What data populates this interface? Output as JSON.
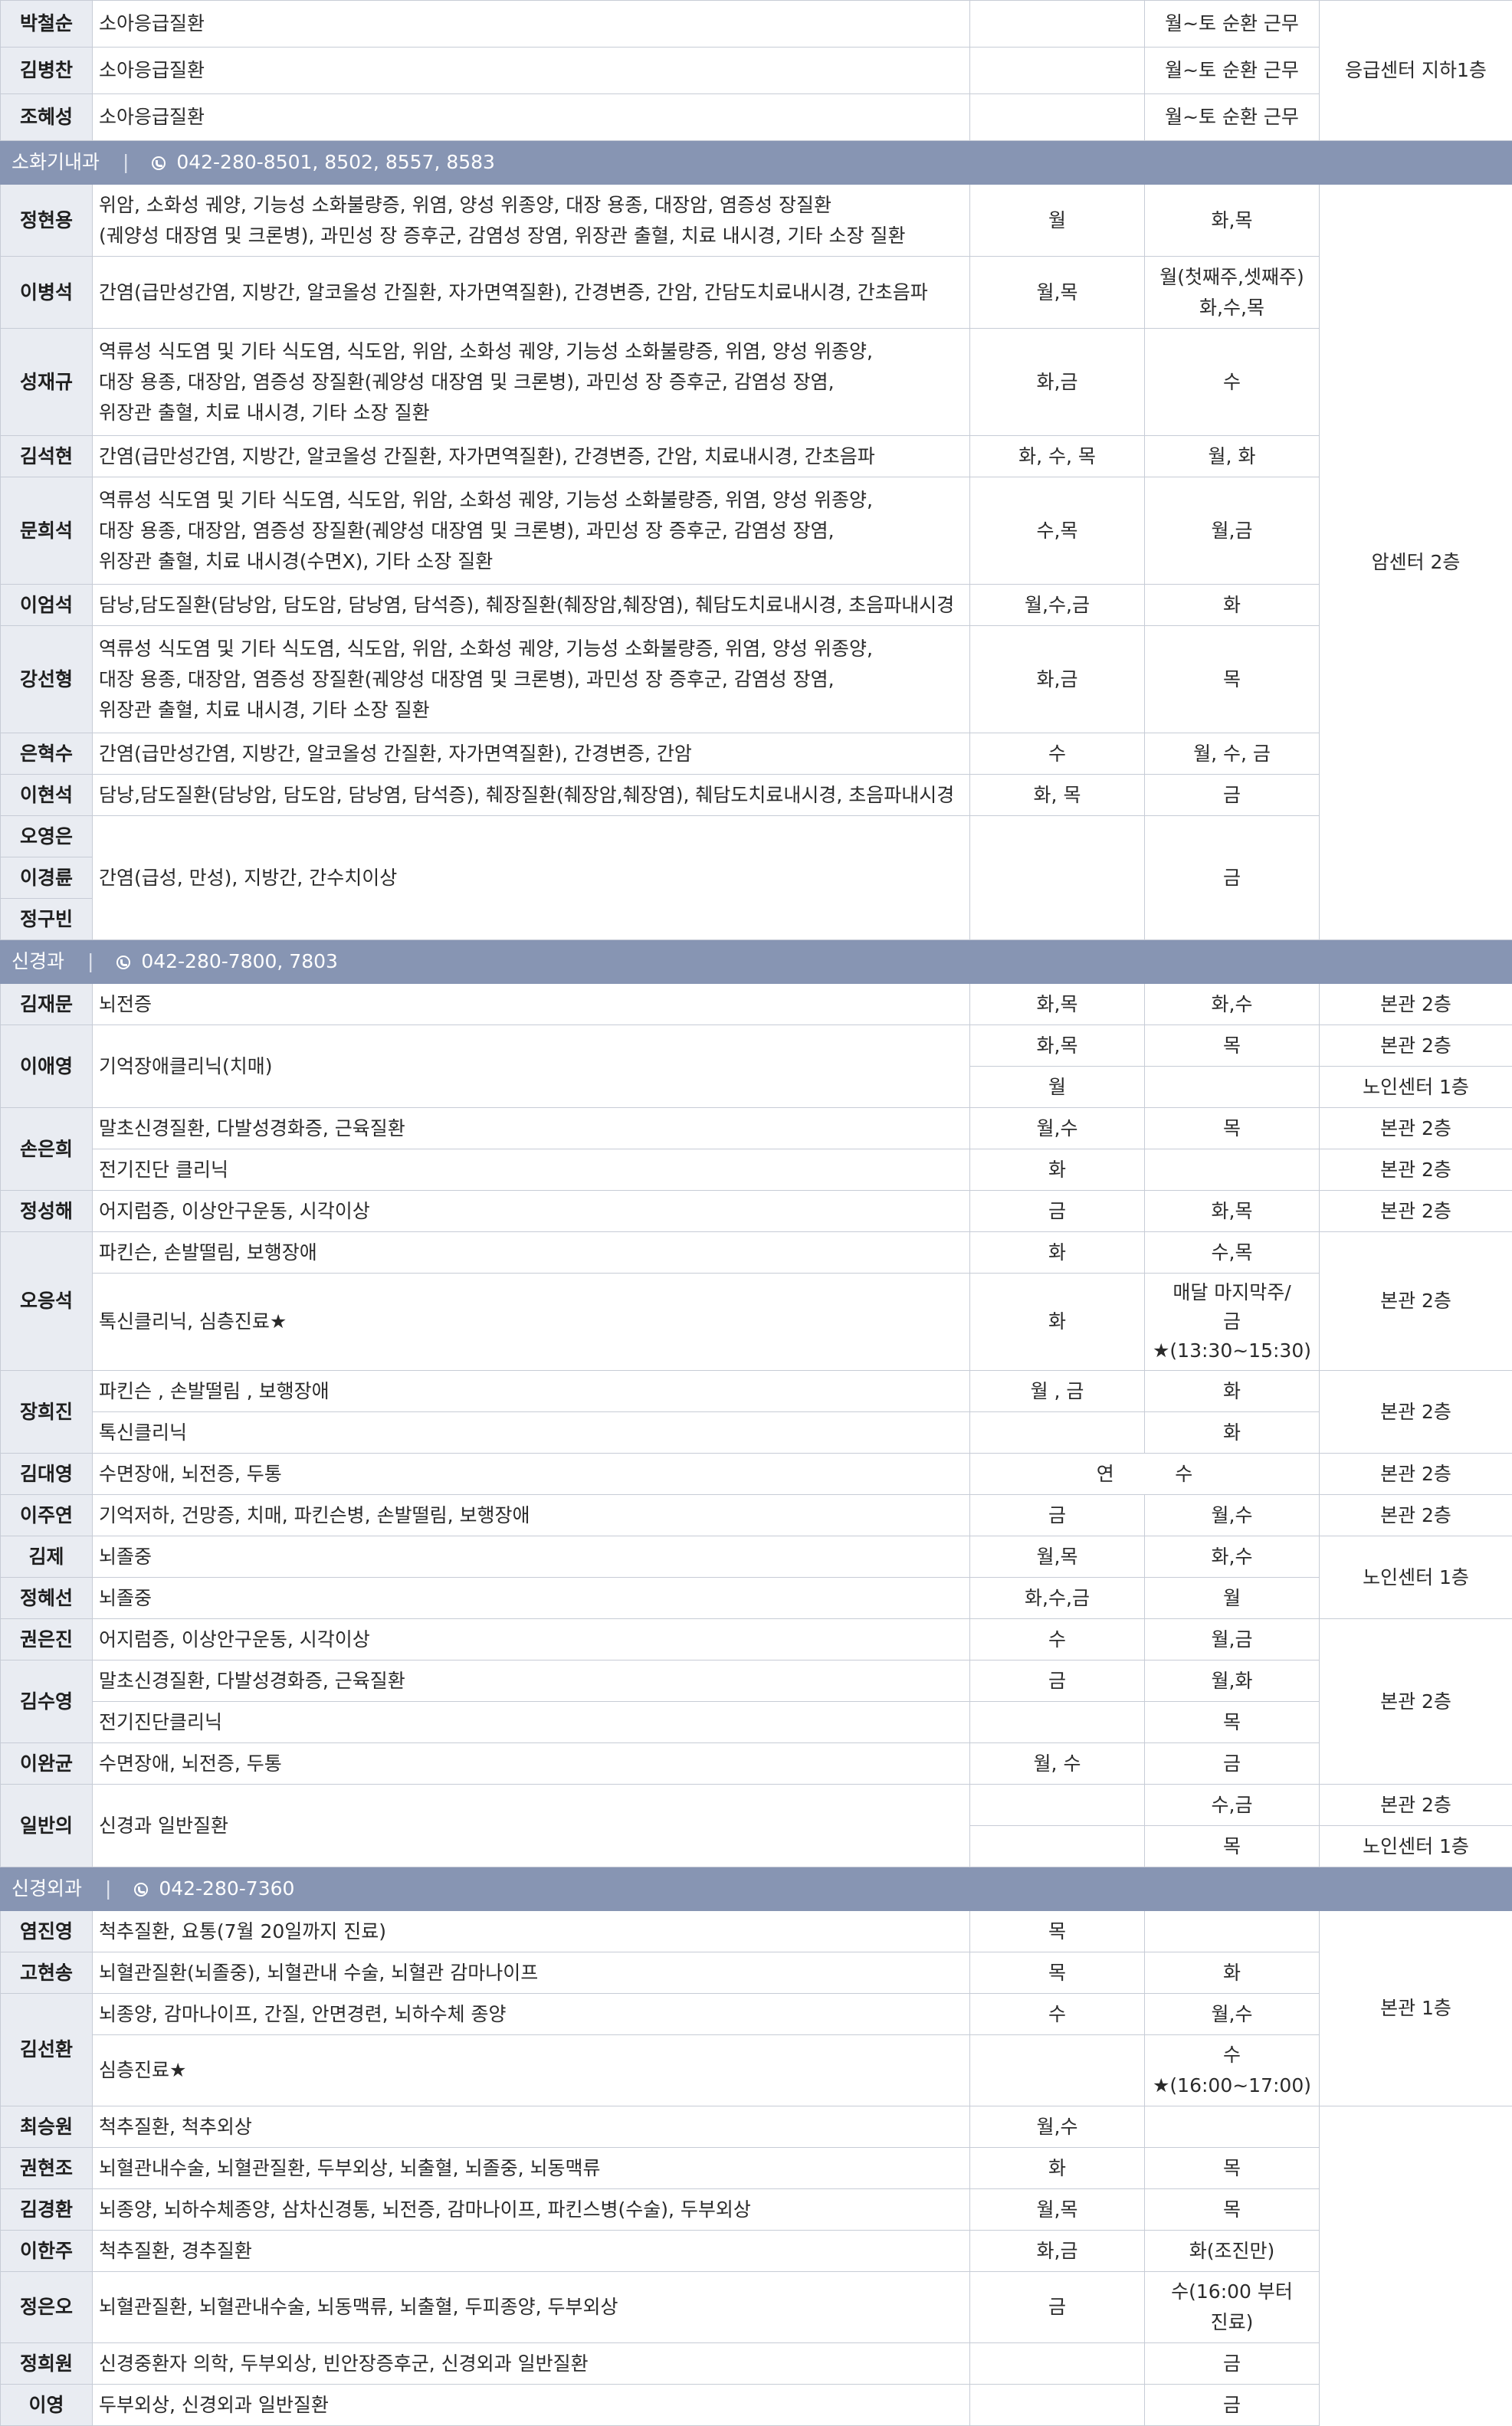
{
  "top_section": {
    "location": "응급센터 지하1층",
    "rows": [
      {
        "name": "박철순",
        "specialty": "소아응급질환",
        "morning": "",
        "afternoon": "월~토 순환 근무"
      },
      {
        "name": "김병찬",
        "specialty": "소아응급질환",
        "morning": "",
        "afternoon": "월~토 순환 근무"
      },
      {
        "name": "조혜성",
        "specialty": "소아응급질환",
        "morning": "",
        "afternoon": "월~토 순환 근무"
      }
    ]
  },
  "gastro": {
    "title": "소화기내과",
    "phone": "042-280-8501, 8502, 8557, 8583",
    "location": "암센터 2층",
    "rows": [
      {
        "name": "정현용",
        "specialty": "위암, 소화성 궤양, 기능성 소화불량증, 위염, 양성 위종양, 대장 용종, 대장암, 염증성 장질환\n(궤양성 대장염 및 크론병), 과민성 장 증후군, 감염성 장염, 위장관 출혈, 치료 내시경, 기타 소장 질환",
        "morning": "월",
        "afternoon": "화,목"
      },
      {
        "name": "이병석",
        "specialty": "간염(급만성간염, 지방간, 알코올성 간질환, 자가면역질환), 간경변증, 간암, 간담도치료내시경, 간초음파",
        "morning": "월,목",
        "afternoon": "월(첫째주,셋째주)\n화,수,목"
      },
      {
        "name": "성재규",
        "specialty": "역류성 식도염 및 기타 식도염, 식도암, 위암, 소화성 궤양, 기능성 소화불량증, 위염, 양성 위종양,\n대장 용종, 대장암, 염증성 장질환(궤양성 대장염 및 크론병), 과민성 장 증후군, 감염성 장염,\n위장관 출혈, 치료 내시경, 기타 소장 질환",
        "morning": "화,금",
        "afternoon": "수"
      },
      {
        "name": "김석현",
        "specialty": "간염(급만성간염, 지방간, 알코올성 간질환, 자가면역질환), 간경변증, 간암, 치료내시경, 간초음파",
        "morning": "화, 수, 목",
        "afternoon": "월, 화"
      },
      {
        "name": "문희석",
        "specialty": "역류성 식도염 및 기타 식도염, 식도암, 위암, 소화성 궤양, 기능성 소화불량증, 위염, 양성 위종양,\n대장 용종, 대장암, 염증성 장질환(궤양성 대장염 및 크론병), 과민성 장 증후군, 감염성 장염,\n위장관 출혈, 치료 내시경(수면X), 기타 소장 질환",
        "morning": "수,목",
        "afternoon": "월,금"
      },
      {
        "name": "이엄석",
        "specialty": "담낭,담도질환(담낭암, 담도암, 담낭염, 담석증), 췌장질환(췌장암,췌장염), 췌담도치료내시경, 초음파내시경",
        "morning": "월,수,금",
        "afternoon": "화"
      },
      {
        "name": "강선형",
        "specialty": "역류성 식도염 및 기타 식도염, 식도암, 위암, 소화성 궤양, 기능성 소화불량증, 위염, 양성 위종양,\n대장 용종, 대장암, 염증성 장질환(궤양성 대장염 및 크론병), 과민성 장 증후군, 감염성 장염,\n위장관 출혈, 치료 내시경, 기타 소장 질환",
        "morning": "화,금",
        "afternoon": "목"
      },
      {
        "name": "은혁수",
        "specialty": "간염(급만성간염, 지방간, 알코올성 간질환, 자가면역질환), 간경변증, 간암",
        "morning": "수",
        "afternoon": "월, 수, 금"
      },
      {
        "name": "이현석",
        "specialty": "담낭,담도질환(담낭암, 담도암, 담낭염, 담석증), 췌장질환(췌장암,췌장염), 췌담도치료내시경, 초음파내시경",
        "morning": "화, 목",
        "afternoon": "금"
      }
    ],
    "group": {
      "names": [
        "오영은",
        "이경륜",
        "정구빈"
      ],
      "specialty": "간염(급성, 만성), 지방간, 간수치이상",
      "morning": "",
      "afternoon": "금"
    }
  },
  "neuro": {
    "title": "신경과",
    "phone": "042-280-7800, 7803",
    "loc_main2": "본관 2층",
    "loc_senior1": "노인센터 1층",
    "rows": {
      "kimjaemun": {
        "name": "김재문",
        "specialty": "뇌전증",
        "morning": "화,목",
        "afternoon": "화,수"
      },
      "leeaeyoung": {
        "name": "이애영",
        "specialty": "기억장애클리닉(치매)",
        "r1_morning": "화,목",
        "r1_afternoon": "목",
        "r2_morning": "월",
        "r2_afternoon": ""
      },
      "soneunhee": {
        "name": "손은희",
        "r1_specialty": "말초신경질환, 다발성경화증, 근육질환",
        "r1_morning": "월,수",
        "r1_afternoon": "목",
        "r2_specialty": "전기진단 클리닉",
        "r2_morning": "화",
        "r2_afternoon": ""
      },
      "jungsunghae": {
        "name": "정성해",
        "specialty": "어지럼증, 이상안구운동, 시각이상",
        "morning": "금",
        "afternoon": "화,목"
      },
      "oheungseok": {
        "name": "오응석",
        "r1_specialty": "파킨슨, 손발떨림, 보행장애",
        "r1_morning": "화",
        "r1_afternoon": "수,목",
        "r2_specialty": "톡신클리닉, 심층진료★",
        "r2_morning": "화",
        "r2_afternoon": "매달 마지막주/\n금★(13:30~15:30)"
      },
      "janghuijin": {
        "name": "장희진",
        "r1_specialty": "파킨슨 , 손발떨림 , 보행장애",
        "r1_morning": "월 , 금",
        "r1_afternoon": "화",
        "r2_specialty": "톡신클리닉",
        "r2_morning": "",
        "r2_afternoon": "화"
      },
      "kimdaeyoung": {
        "name": "김대영",
        "specialty": "수면장애, 뇌전증, 두통",
        "merged": "연          수"
      },
      "leejuyeon": {
        "name": "이주연",
        "specialty": "기억저하, 건망증, 치매, 파킨슨병, 손발떨림, 보행장애",
        "morning": "금",
        "afternoon": "월,수"
      },
      "kimje": {
        "name": "김제",
        "specialty": "뇌졸중",
        "morning": "월,목",
        "afternoon": "화,수"
      },
      "junghyesun": {
        "name": "정혜선",
        "specialty": "뇌졸중",
        "morning": "화,수,금",
        "afternoon": "월"
      },
      "kwoneunjin": {
        "name": "권은진",
        "specialty": "어지럼증, 이상안구운동, 시각이상",
        "morning": "수",
        "afternoon": "월,금"
      },
      "kimsooyoung": {
        "name": "김수영",
        "r1_specialty": "말초신경질환, 다발성경화증, 근육질환",
        "r1_morning": "금",
        "r1_afternoon": "월,화",
        "r2_specialty": "전기진단클리닉",
        "r2_morning": "",
        "r2_afternoon": "목"
      },
      "leewankyu": {
        "name": "이완균",
        "specialty": "수면장애, 뇌전증, 두통",
        "morning": "월, 수",
        "afternoon": "금"
      },
      "general": {
        "name": "일반의",
        "specialty": "신경과 일반질환",
        "r1_morning": "",
        "r1_afternoon": "수,금",
        "r2_morning": "",
        "r2_afternoon": "목"
      }
    }
  },
  "neurosurgery": {
    "title": "신경외과",
    "phone": "042-280-7360",
    "location": "본관 1층",
    "rows": [
      {
        "name": "염진영",
        "specialty": "척추질환, 요통(7월 20일까지 진료)",
        "morning": "목",
        "afternoon": ""
      },
      {
        "name": "고현송",
        "specialty": "뇌혈관질환(뇌졸중), 뇌혈관내 수술, 뇌혈관 감마나이프",
        "morning": "목",
        "afternoon": "화"
      }
    ],
    "kimsunhwan": {
      "name": "김선환",
      "r1_specialty": "뇌종양, 감마나이프, 간질, 안면경련, 뇌하수체 종양",
      "r1_morning": "수",
      "r1_afternoon": "월,수",
      "r2_specialty": "심층진료★",
      "r2_morning": "",
      "r2_afternoon": "수★(16:00~17:00)"
    },
    "rows2": [
      {
        "name": "최승원",
        "specialty": "척추질환, 척추외상",
        "morning": "월,수",
        "afternoon": ""
      },
      {
        "name": "권현조",
        "specialty": "뇌혈관내수술, 뇌혈관질환, 두부외상, 뇌출혈, 뇌졸중, 뇌동맥류",
        "morning": "화",
        "afternoon": "목"
      },
      {
        "name": "김경환",
        "specialty": "뇌종양, 뇌하수체종양, 삼차신경통, 뇌전증, 감마나이프, 파킨스병(수술), 두부외상",
        "morning": "월,목",
        "afternoon": "목"
      },
      {
        "name": "이한주",
        "specialty": "척추질환, 경추질환",
        "morning": "화,금",
        "afternoon": "화(조진만)"
      },
      {
        "name": "정은오",
        "specialty": "뇌혈관질환, 뇌혈관내수술, 뇌동맥류, 뇌출혈, 두피종양, 두부외상",
        "morning": "금",
        "afternoon": "수(16:00 부터 진료)"
      },
      {
        "name": "정희원",
        "specialty": "신경중환자 의학, 두부외상, 빈안장증후군, 신경외과 일반질환",
        "morning": "",
        "afternoon": "금"
      },
      {
        "name": "이영",
        "specialty": "두부외상, 신경외과 일반질환",
        "morning": "",
        "afternoon": "금"
      }
    ]
  },
  "colors": {
    "header_bg": "#8795b3",
    "name_bg": "#e9ecf2",
    "border": "#c7ccd6"
  },
  "icons": {
    "phone": "phone-icon"
  }
}
